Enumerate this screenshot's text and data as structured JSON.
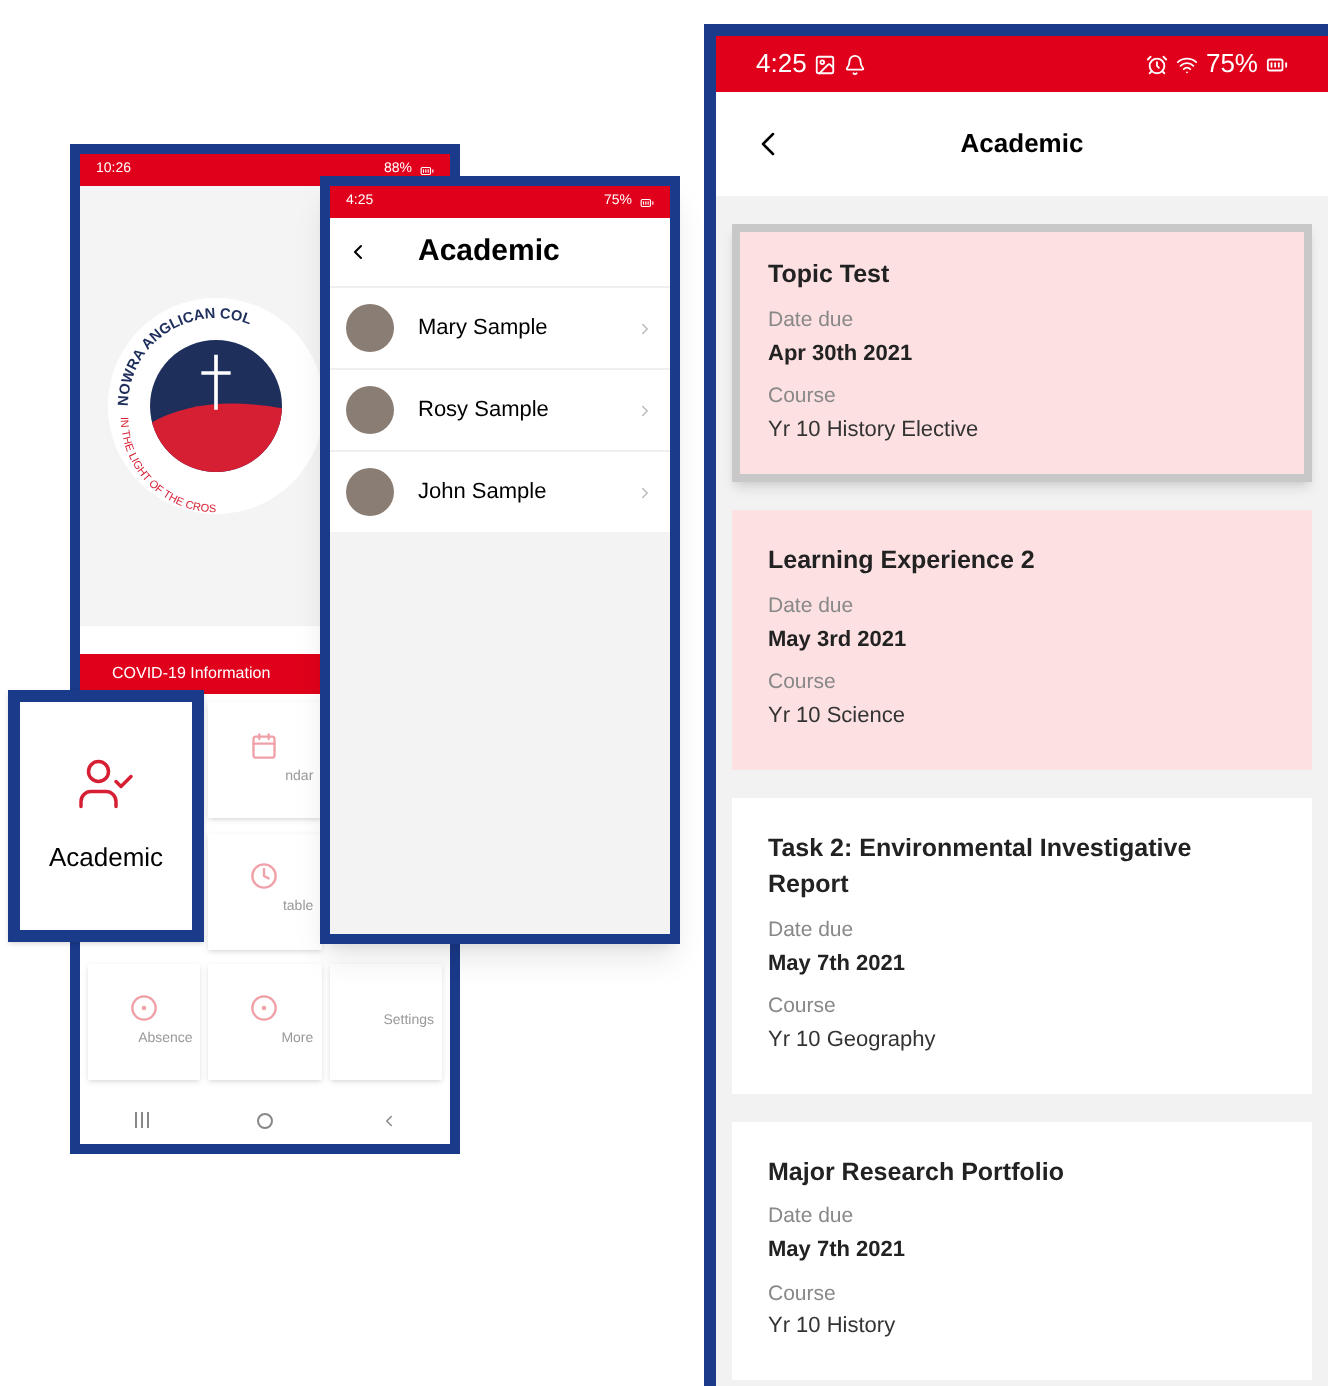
{
  "home_phone": {
    "status_time": "10:26",
    "battery": "88%",
    "logo_top_text": "NOWRA ANGLICAN COL",
    "logo_bottom_text": "IN THE LIGHT OF THE CROS",
    "banner": "COVID-19 Information",
    "tiles": [
      {
        "kind": "hidden"
      },
      {
        "kind": "calendar",
        "label": "ndar"
      },
      {
        "kind": "hidden"
      },
      {
        "kind": "hidden"
      },
      {
        "kind": "clock",
        "label": "table"
      },
      {
        "kind": "hidden"
      },
      {
        "kind": "circle",
        "label": "Absence"
      },
      {
        "kind": "circle",
        "label": "More"
      },
      {
        "kind": "blank",
        "label": "Settings"
      }
    ]
  },
  "list_phone": {
    "status_time": "4:25",
    "battery": "75%",
    "title": "Academic",
    "students": [
      {
        "name": "Mary Sample"
      },
      {
        "name": "Rosy Sample"
      },
      {
        "name": "John Sample"
      }
    ]
  },
  "callout": {
    "label": "Academic"
  },
  "detail_phone": {
    "status_time": "4:25",
    "battery": "75%",
    "title": "Academic",
    "tasks": [
      {
        "title": "Topic Test",
        "date_label": "Date due",
        "date": "Apr 30th 2021",
        "course_label": "Course",
        "course": "Yr 10 History Elective",
        "highlighted": true,
        "selected": true
      },
      {
        "title": "Learning Experience 2",
        "date_label": "Date due",
        "date": "May 3rd 2021",
        "course_label": "Course",
        "course": "Yr 10 Science",
        "highlighted": true,
        "selected": false
      },
      {
        "title": "Task 2: Environmental Investigative Report",
        "date_label": "Date due",
        "date": "May 7th 2021",
        "course_label": "Course",
        "course": "Yr 10 Geography",
        "highlighted": false,
        "selected": false
      },
      {
        "title": "Major Research Portfolio",
        "date_label": "Date due",
        "date": "May 7th 2021",
        "course_label": "Course",
        "course": "Yr 10 History",
        "highlighted": false,
        "selected": false
      }
    ]
  }
}
